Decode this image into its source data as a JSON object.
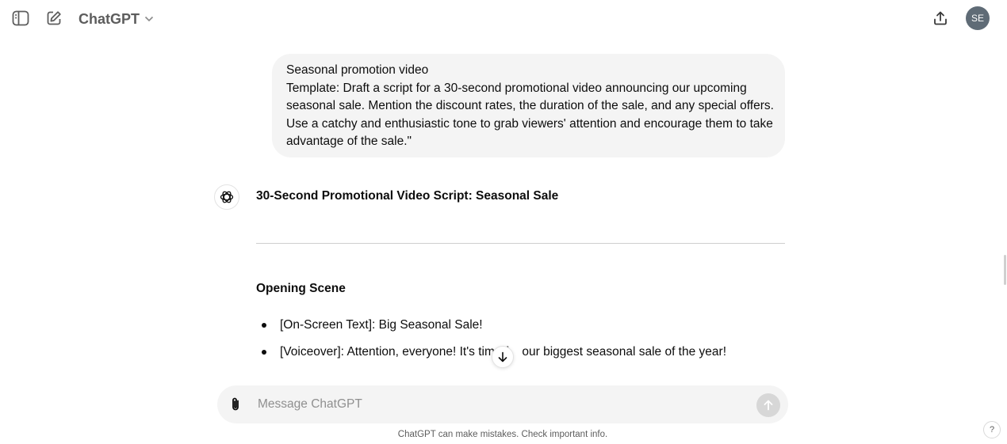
{
  "header": {
    "model_name": "ChatGPT",
    "avatar_initials": "SE",
    "icons": [
      "sidebar-toggle-icon",
      "new-chat-icon",
      "chevron-down-icon",
      "share-icon"
    ]
  },
  "conversation": {
    "user_message": {
      "lines": [
        "Seasonal promotion video",
        "Template: Draft a script for a 30-second promotional video announcing our upcoming",
        "seasonal sale. Mention the discount rates, the duration of the sale, and any special offers.",
        "Use a catchy and enthusiastic tone to grab viewers' attention and encourage them to take",
        "advantage of the sale.\""
      ]
    },
    "assistant_message": {
      "heading": "30-Second Promotional Video Script: Seasonal Sale",
      "section_heading": "Opening Scene",
      "bullets": [
        "[On-Screen Text]: Big Seasonal Sale!",
        "[Voiceover]: Attention, everyone! It's time f    our biggest seasonal sale of the year!"
      ]
    }
  },
  "composer": {
    "placeholder": "Message ChatGPT",
    "value": ""
  },
  "footer": {
    "disclaimer": "ChatGPT can make mistakes. Check important info.",
    "help_label": "?"
  },
  "colors": {
    "background": "#ffffff",
    "bubble": "#f4f4f4",
    "text": "#0d0d0d",
    "muted": "#5d5d5d",
    "avatar": "#5f6b76",
    "send_disabled": "#d7d7d7"
  }
}
